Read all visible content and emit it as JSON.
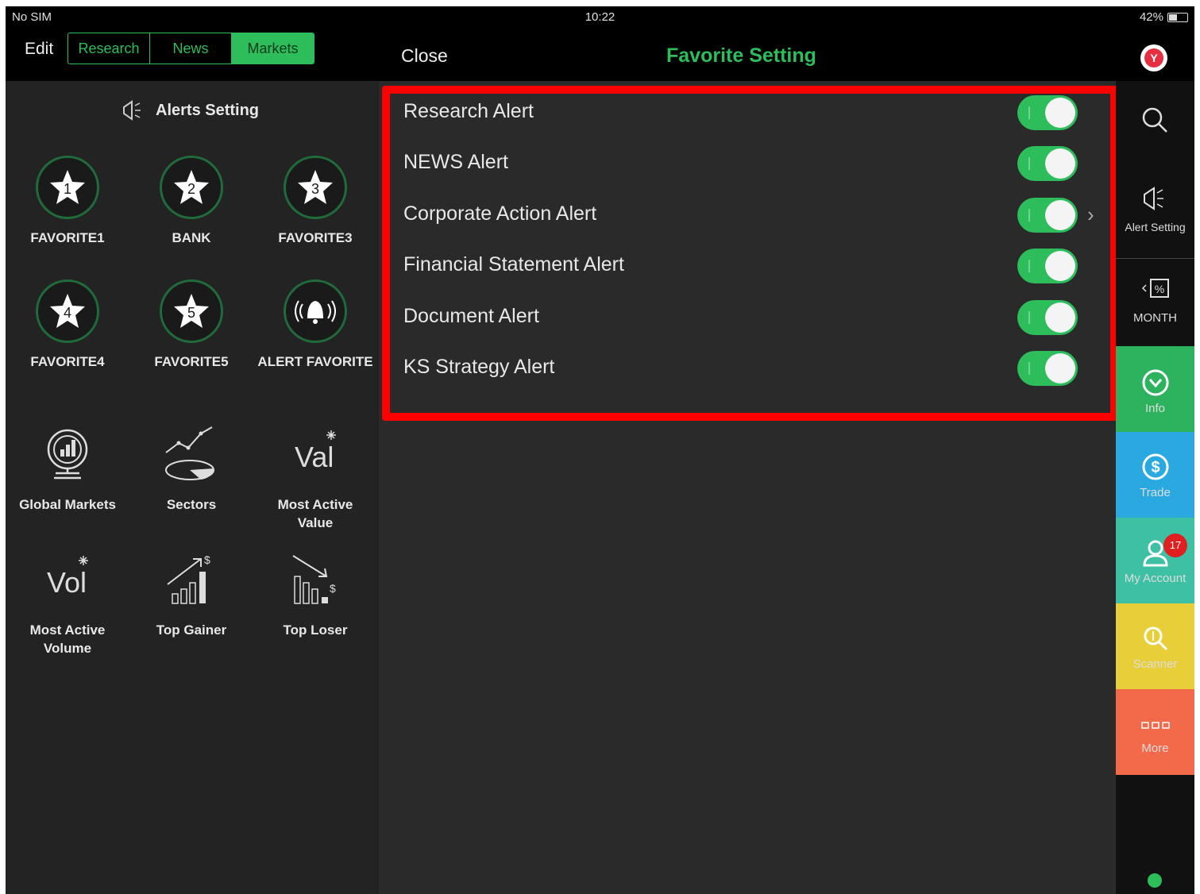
{
  "status_bar": {
    "carrier": "No SIM",
    "time": "10:22",
    "battery": "42%"
  },
  "header": {
    "edit_label": "Edit",
    "tabs": [
      {
        "label": "Research",
        "active": false
      },
      {
        "label": "News",
        "active": false
      },
      {
        "label": "Markets",
        "active": true
      }
    ],
    "close_label": "Close",
    "title": "Favorite Setting",
    "logo_icon": "app-logo-icon"
  },
  "left_panel": {
    "alerts_setting_label": "Alerts Setting",
    "favorites": [
      {
        "number": "1",
        "label": "FAVORITE1"
      },
      {
        "number": "2",
        "label": "BANK"
      },
      {
        "number": "3",
        "label": "FAVORITE3"
      },
      {
        "number": "4",
        "label": "FAVORITE4"
      },
      {
        "number": "5",
        "label": "FAVORITE5"
      },
      {
        "number": "",
        "label": "ALERT FAVORITE"
      }
    ],
    "tools": [
      {
        "icon": "globe-chart-icon",
        "label_line1": "Global Markets",
        "label_line2": ""
      },
      {
        "icon": "sectors-pie-icon",
        "label_line1": "Sectors",
        "label_line2": ""
      },
      {
        "icon": "val-icon",
        "icon_text": "Val",
        "label_line1": "Most Active",
        "label_line2": "Value"
      },
      {
        "icon": "vol-icon",
        "icon_text": "Vol",
        "label_line1": "Most Active",
        "label_line2": "Volume"
      },
      {
        "icon": "top-gainer-icon",
        "label_line1": "Top Gainer",
        "label_line2": ""
      },
      {
        "icon": "top-loser-icon",
        "label_line1": "Top Loser",
        "label_line2": ""
      }
    ]
  },
  "alerts": [
    {
      "label": "Research Alert",
      "enabled": true
    },
    {
      "label": "NEWS Alert",
      "enabled": true
    },
    {
      "label": "Corporate Action Alert",
      "enabled": true
    },
    {
      "label": "Financial Statement Alert",
      "enabled": true
    },
    {
      "label": "Document Alert",
      "enabled": true
    },
    {
      "label": "KS Strategy Alert",
      "enabled": true
    }
  ],
  "right_rail": {
    "items": [
      {
        "icon": "search-icon",
        "label": ""
      },
      {
        "icon": "alert-setting-icon",
        "label": "Alert Setting"
      },
      {
        "icon": "month-percent-icon",
        "label": "MONTH"
      },
      {
        "icon": "info-icon",
        "label": "Info",
        "color": "#2db35e"
      },
      {
        "icon": "trade-dollar-icon",
        "label": "Trade",
        "color": "#29a9e0"
      },
      {
        "icon": "account-icon",
        "label": "My Account",
        "color": "#3ec0a4",
        "badge": "17"
      },
      {
        "icon": "scanner-icon",
        "label": "Scanner",
        "color": "#e8cf3a"
      },
      {
        "icon": "more-icon",
        "label": "More",
        "color": "#f36a4a"
      }
    ]
  },
  "colors": {
    "accent_green": "#2dbd5a",
    "highlight_red": "#ff0000"
  }
}
